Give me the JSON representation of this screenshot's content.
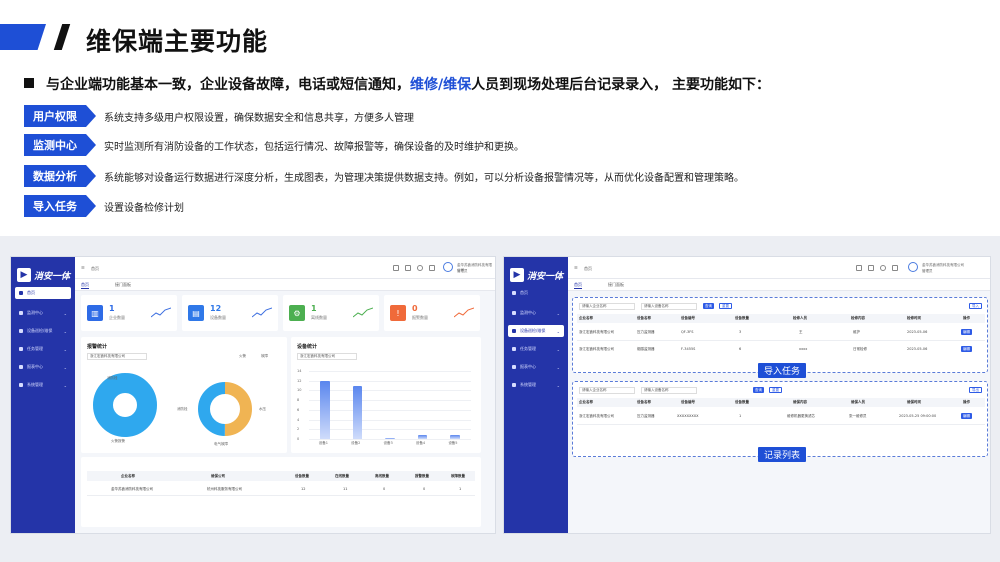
{
  "title": "维保端主要功能",
  "intro": {
    "part1": "与企业端功能基本一致，企业设备故障，电话或短信通知，",
    "highlight": "维修/维保",
    "part2": "人员到现场处理后台记录录入， 主要功能如下："
  },
  "features": [
    {
      "tag": "用户权限",
      "desc": "系统支持多级用户权限设置，确保数据安全和信息共享，方便多人管理"
    },
    {
      "tag": "监测中心",
      "desc": "实时监测所有消防设备的工作状态，包括运行情况、故障报警等，确保设备的及时维护和更换。"
    },
    {
      "tag": "数据分析",
      "desc": "系统能够对设备运行数据进行深度分析，生成图表，为管理决策提供数据支持。例如，可以分析设备报警情况等，从而优化设备配置和管理策略。"
    },
    {
      "tag": "导入任务",
      "desc": "设置设备检修计划"
    }
  ],
  "colors": {
    "accent": "#1e4fd6",
    "sidebar": "#2434a8"
  },
  "app1": {
    "logo": "消安一体",
    "breadcrumb": "首页",
    "company": "金华苏鑫消防科技有限公司",
    "role": "管理员",
    "menu": [
      "首页",
      "监测中心",
      "设备巡检/维保",
      "任务管理",
      "报表中心",
      "系统管理"
    ],
    "tabs": [
      "首页",
      "接门面板"
    ],
    "stats": [
      {
        "icon": "building-icon",
        "value": "1",
        "label": "企业数量",
        "color": "#2e6be6"
      },
      {
        "icon": "device-icon",
        "value": "12",
        "label": "设备数量",
        "color": "#2f78e8"
      },
      {
        "icon": "gear-icon",
        "value": "1",
        "label": "离线数量",
        "color": "#4caf50"
      },
      {
        "icon": "alert-icon",
        "value": "0",
        "label": "报警数量",
        "color": "#f06a3a"
      }
    ],
    "alarm_card": {
      "title": "报警统计",
      "select": "浙江宏鑫科技有限公司",
      "legend_a": "火警",
      "legend_b": "故障",
      "pie1_label": "火警报警",
      "pie2_label": "电气故障",
      "pie_tag_a": "消防栓",
      "pie_tag_b": "水压"
    },
    "device_card": {
      "title": "设备统计",
      "select": "浙江宏鑫科技有限公司"
    },
    "table": {
      "headers": [
        "企业名称",
        "维保公司",
        "设备数量",
        "在线数量",
        "离线数量",
        "报警数量",
        "故障数量"
      ],
      "row": [
        "金华苏鑫消防科技有限公司",
        "杭州科技服务有限公司",
        "12",
        "11",
        "0",
        "0",
        "1"
      ]
    }
  },
  "chart_data": {
    "type": "bar",
    "categories": [
      "设备1",
      "设备2",
      "设备3",
      "设备4",
      "设备5"
    ],
    "values": [
      12,
      11,
      0.3,
      0.8,
      0.8
    ],
    "yticks": [
      "14",
      "12",
      "10",
      "8",
      "6",
      "4",
      "2",
      "0"
    ],
    "ylim": [
      0,
      14
    ]
  },
  "app2": {
    "logo": "消安一体",
    "breadcrumb": "首页",
    "company": "金华苏鑫消防科技有限公司",
    "role": "管理员",
    "menu": [
      "首页",
      "监测中心",
      "设备巡检/维保",
      "任务管理",
      "报表中心",
      "系统管理"
    ],
    "tabs": [
      "首页",
      "接门面板"
    ],
    "callout1": "导入任务",
    "callout2": "记录列表",
    "task_panel": {
      "search_a": "请输入企业名称",
      "search_b": "请输入设备名称",
      "btn_search": "查询",
      "btn_reset": "重置",
      "btn_import": "导入",
      "headers": [
        "企业名称",
        "设备名称",
        "设备编号",
        "设备数量",
        "检修人员",
        "检修内容",
        "检修时间",
        "操作"
      ],
      "rows": [
        [
          "浙江宏鑫科技有限公司",
          "压力监测器",
          "QF-3FS",
          "3",
          "王",
          "维护",
          "2023-05-06",
          "编辑"
        ],
        [
          "浙江宏鑫科技有限公司",
          "烟感监测器",
          "F-3455S",
          "6",
          "xxxx",
          "日常检修",
          "2023-05-06",
          "编辑"
        ]
      ]
    },
    "record_panel": {
      "search_a": "请输入企业名称",
      "search_b": "请输入设备名称",
      "btn_search": "查询",
      "btn_reset": "重置",
      "btn_export": "导出",
      "headers": [
        "企业名称",
        "设备名称",
        "设备编号",
        "设备数量",
        "维保内容",
        "维保人员",
        "维保时间",
        "操作"
      ],
      "rows": [
        [
          "浙江宏鑫科技有限公司",
          "压力监测器",
          "XXXXXXXXX",
          "1",
          "维修机器更换滤芯",
          "张一维修员",
          "2023-05-25 09:00:00",
          "编辑"
        ]
      ]
    }
  }
}
